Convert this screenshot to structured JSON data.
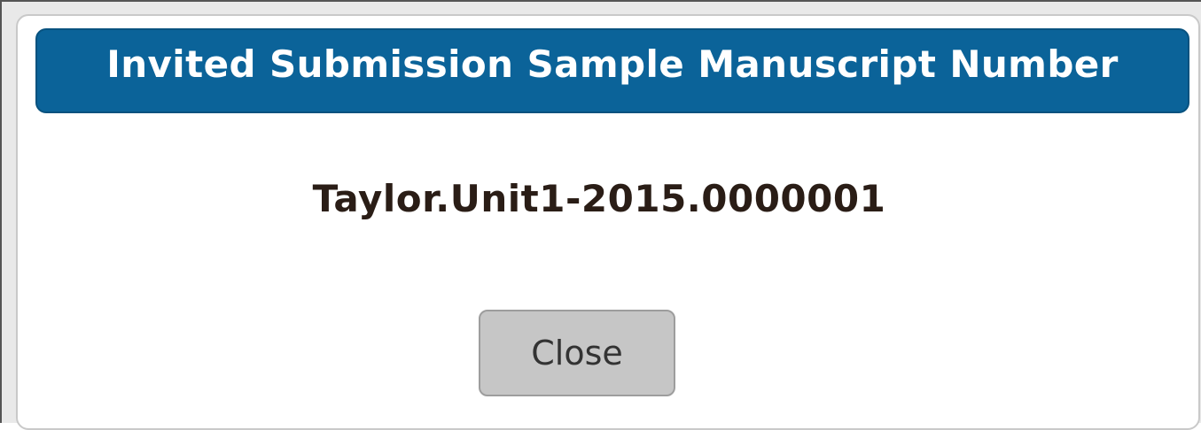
{
  "dialog": {
    "title": "Invited Submission Sample Manuscript Number",
    "manuscript_number": "Taylor.Unit1-2015.0000001",
    "close_label": "Close"
  },
  "colors": {
    "title_bar": "#0b6399",
    "title_text": "#ffffff",
    "number_text": "#2a1d16",
    "button_bg": "#c6c6c6"
  }
}
